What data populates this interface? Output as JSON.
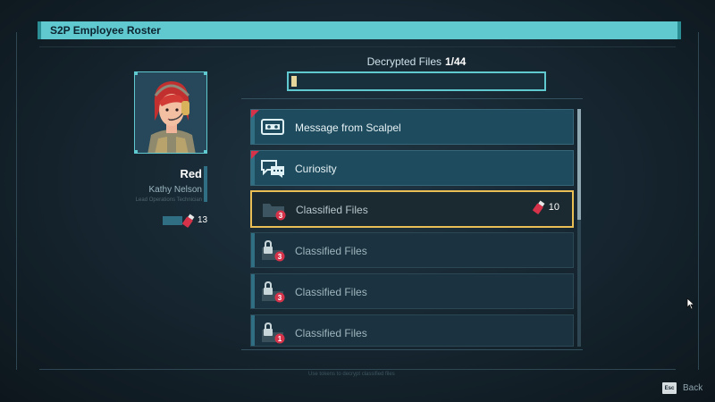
{
  "window": {
    "title": "S2P Employee Roster"
  },
  "progress": {
    "label": "Decrypted Files",
    "value_text": "1/44",
    "decrypted": 1,
    "total": 44
  },
  "character": {
    "code_name": "Red",
    "real_name": "Kathy Nelson",
    "subtitle": "Lead Operations Technician",
    "tokens": "13"
  },
  "files": [
    {
      "title": "Message from Scalpel",
      "icon": "tape-icon",
      "state": "unread",
      "badge": ""
    },
    {
      "title": "Curiosity",
      "icon": "chat-bubbles-icon",
      "state": "unread",
      "badge": ""
    },
    {
      "title": "Classified Files",
      "icon": "folder-icon",
      "state": "selected",
      "badge": "3",
      "cost": "10"
    },
    {
      "title": "Classified Files",
      "icon": "lock-folder-icon",
      "state": "locked",
      "badge": "3"
    },
    {
      "title": "Classified Files",
      "icon": "lock-folder-icon",
      "state": "locked",
      "badge": "3"
    },
    {
      "title": "Classified Files",
      "icon": "lock-folder-icon",
      "state": "locked",
      "badge": "1"
    }
  ],
  "footer": {
    "hint": "Use tokens to decrypt classified files",
    "esc_key": "Esc",
    "back_label": "Back"
  },
  "colors": {
    "accent": "#5fc9cf",
    "selection": "#e9bf55",
    "alert": "#d6334a"
  }
}
